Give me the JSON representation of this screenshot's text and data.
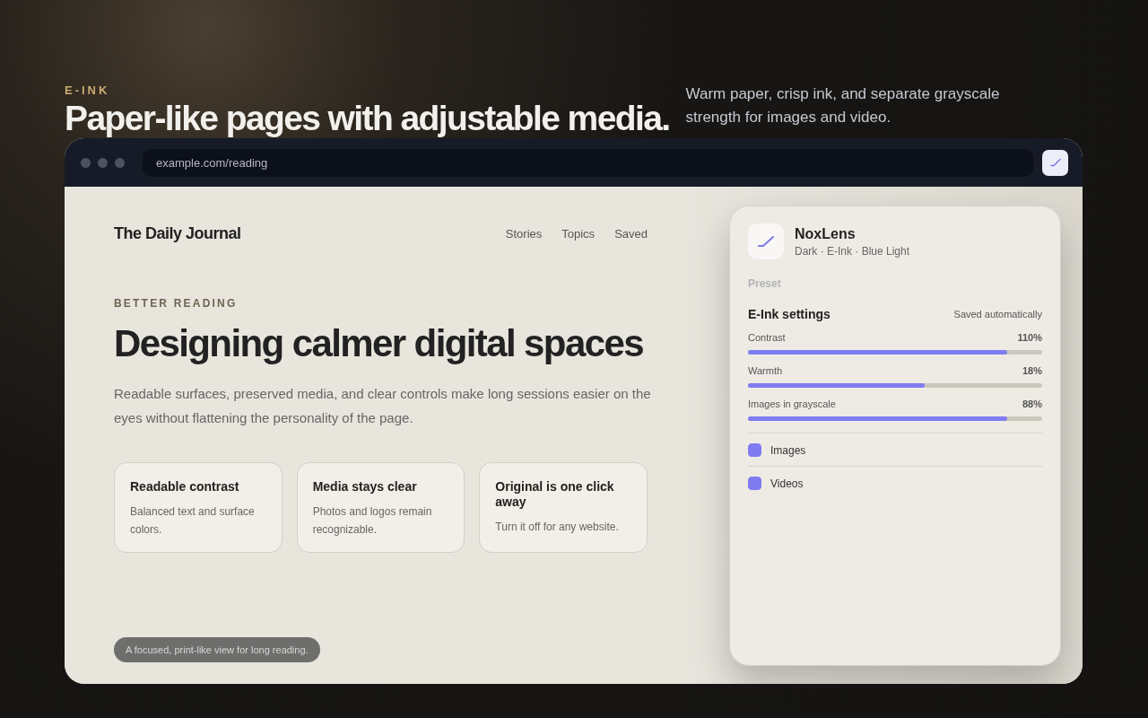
{
  "hero": {
    "eyebrow": "E-INK",
    "title": "Paper-like pages with adjustable media.",
    "subtitle": "Warm paper, crisp ink, and separate grayscale strength for images and video."
  },
  "browser": {
    "url": "example.com/reading"
  },
  "site": {
    "name": "The Daily Journal",
    "nav": [
      "Stories",
      "Topics",
      "Saved"
    ]
  },
  "article": {
    "eyebrow": "BETTER READING",
    "title": "Designing calmer digital spaces",
    "body": "Readable surfaces, preserved media, and clear controls make long sessions easier on the eyes without flattening the personality of the page.",
    "cards": [
      {
        "title": "Readable contrast",
        "text": "Balanced text and surface colors."
      },
      {
        "title": "Media stays clear",
        "text": "Photos and logos remain recognizable."
      },
      {
        "title": "Original is one click away",
        "text": "Turn it off for any website."
      }
    ],
    "caption": "A focused, print-like view for long reading."
  },
  "panel": {
    "name": "NoxLens",
    "modes": "Dark · E-Ink · Blue Light",
    "preset": "Preset",
    "section": "E-Ink settings",
    "saved": "Saved automatically",
    "sliders": [
      {
        "label": "Contrast",
        "reading": "110%",
        "level": 0.88
      },
      {
        "label": "Warmth",
        "reading": "18%",
        "level": 0.6
      },
      {
        "label": "Images in grayscale",
        "reading": "88%",
        "level": 0.88
      }
    ],
    "toggles": [
      {
        "label": "Images",
        "checked": true
      },
      {
        "label": "Videos",
        "checked": true
      }
    ]
  }
}
